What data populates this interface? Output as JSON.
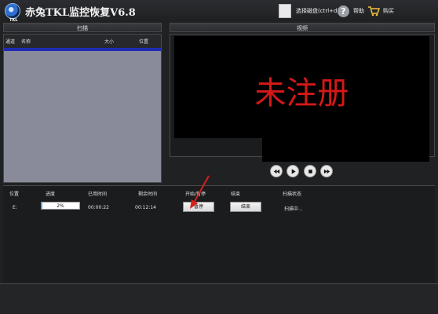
{
  "titlebar": {
    "app_title": "赤兔TKL监控恢复V6.8",
    "logo_text": "TKL",
    "select_disk_label": "选择磁盘(ctrl+d)",
    "help_label": "帮助",
    "buy_label": "购买"
  },
  "scan_panel": {
    "header": "扫描",
    "columns": [
      "通道",
      "名称",
      "大小",
      "位置"
    ]
  },
  "video_panel": {
    "header": "视频",
    "overlay_text": "未注册",
    "overlay_color": "#d41818",
    "controls": [
      "rewind-icon",
      "play-icon",
      "stop-icon",
      "fast-forward-icon"
    ]
  },
  "task_table": {
    "columns": [
      "位置",
      "进度",
      "已用时间",
      "剩余时间",
      "开始/暂停",
      "结束",
      "扫描状态"
    ],
    "row": {
      "location": "E:",
      "progress_text": "2%",
      "progress_value": 0.02,
      "elapsed": "00:00:22",
      "remaining": "00:12:14",
      "pause_label": "暂停",
      "end_label": "结束",
      "status": "扫描中..."
    }
  },
  "colors": {
    "scan_selection": "#1f2bb0",
    "scan_bg": "#8a8b9a",
    "arrow": "#d42020"
  }
}
